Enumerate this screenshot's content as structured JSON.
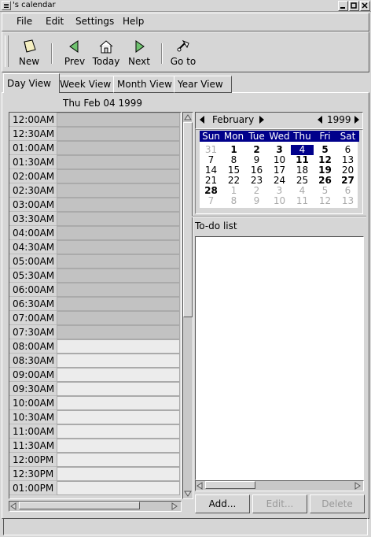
{
  "window": {
    "title": "'s calendar"
  },
  "menu": {
    "file": "File",
    "edit": "Edit",
    "settings": "Settings",
    "help": "Help"
  },
  "toolbar": {
    "new": "New",
    "prev": "Prev",
    "today": "Today",
    "next": "Next",
    "goto": "Go to"
  },
  "tabs": [
    "Day View",
    "Week View",
    "Month View",
    "Year View"
  ],
  "day": {
    "date": "Thu Feb 04 1999",
    "hours": [
      "12:00AM",
      "12:30AM",
      "01:00AM",
      "01:30AM",
      "02:00AM",
      "02:30AM",
      "03:00AM",
      "03:30AM",
      "04:00AM",
      "04:30AM",
      "05:00AM",
      "05:30AM",
      "06:00AM",
      "06:30AM",
      "07:00AM",
      "07:30AM",
      "08:00AM",
      "08:30AM",
      "09:00AM",
      "09:30AM",
      "10:00AM",
      "10:30AM",
      "11:00AM",
      "11:30AM",
      "12:00PM",
      "12:30PM",
      "01:00PM"
    ],
    "work_start_index": 16
  },
  "calendar": {
    "month": "February",
    "year": "1999",
    "weekdays": [
      "Sun",
      "Mon",
      "Tue",
      "Wed",
      "Thu",
      "Fri",
      "Sat"
    ],
    "weeks": [
      [
        {
          "d": "31",
          "o": 1
        },
        {
          "d": "1",
          "b": 1
        },
        {
          "d": "2",
          "b": 1
        },
        {
          "d": "3",
          "b": 1
        },
        {
          "d": "4",
          "s": 1
        },
        {
          "d": "5",
          "b": 1
        },
        {
          "d": "6"
        }
      ],
      [
        {
          "d": "7"
        },
        {
          "d": "8"
        },
        {
          "d": "9"
        },
        {
          "d": "10"
        },
        {
          "d": "11",
          "b": 1
        },
        {
          "d": "12",
          "b": 1
        },
        {
          "d": "13"
        }
      ],
      [
        {
          "d": "14"
        },
        {
          "d": "15"
        },
        {
          "d": "16"
        },
        {
          "d": "17"
        },
        {
          "d": "18"
        },
        {
          "d": "19",
          "b": 1
        },
        {
          "d": "20"
        }
      ],
      [
        {
          "d": "21"
        },
        {
          "d": "22"
        },
        {
          "d": "23"
        },
        {
          "d": "24"
        },
        {
          "d": "25"
        },
        {
          "d": "26",
          "b": 1
        },
        {
          "d": "27",
          "b": 1
        }
      ],
      [
        {
          "d": "28",
          "b": 1
        },
        {
          "d": "1",
          "o": 1
        },
        {
          "d": "2",
          "o": 1
        },
        {
          "d": "3",
          "o": 1
        },
        {
          "d": "4",
          "o": 1
        },
        {
          "d": "5",
          "o": 1
        },
        {
          "d": "6",
          "o": 1
        }
      ],
      [
        {
          "d": "7",
          "o": 1
        },
        {
          "d": "8",
          "o": 1
        },
        {
          "d": "9",
          "o": 1
        },
        {
          "d": "10",
          "o": 1
        },
        {
          "d": "11",
          "o": 1
        },
        {
          "d": "12",
          "o": 1
        },
        {
          "d": "13",
          "o": 1
        }
      ]
    ]
  },
  "todo": {
    "label": "To-do list",
    "add": "Add...",
    "edit": "Edit...",
    "delete": "Delete"
  },
  "colors": {
    "selection": "#00008b",
    "off_hours": "#c2c2c2",
    "work_hours": "#ececec"
  }
}
